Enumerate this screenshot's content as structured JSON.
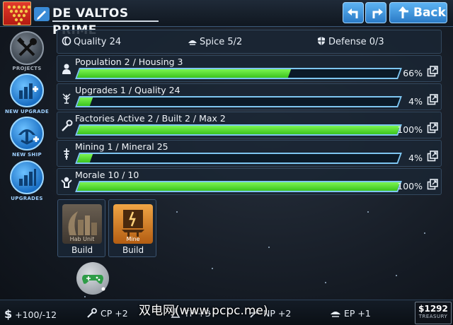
{
  "header": {
    "planet_name": "DE VALTOS PRIME",
    "back_label": "Back"
  },
  "sidebar": [
    {
      "label": "PROJECTS",
      "icon": "tools-icon",
      "style": "gray"
    },
    {
      "label": "NEW UPGRADE",
      "icon": "upgrade-plus-icon",
      "style": "blue"
    },
    {
      "label": "NEW SHIP",
      "icon": "ship-plus-icon",
      "style": "blue"
    },
    {
      "label": "UPGRADES",
      "icon": "upgrades-icon",
      "style": "blue"
    }
  ],
  "stats": {
    "quality": "Quality 24",
    "spice": "Spice 5/2",
    "defense": "Defense 0/3"
  },
  "resources": [
    {
      "label": "Population 2 / Housing 3",
      "percent_text": "66%",
      "fill": 0.66,
      "icon": "population-icon"
    },
    {
      "label": "Upgrades 1 / Quality 24",
      "percent_text": "4%",
      "fill": 0.04,
      "icon": "tree-icon"
    },
    {
      "label": "Factories Active 2 / Built 2 / Max 2",
      "percent_text": "100%",
      "fill": 1.0,
      "icon": "wrench-icon"
    },
    {
      "label": "Mining 1 / Mineral 25",
      "percent_text": "4%",
      "fill": 0.04,
      "icon": "drill-icon"
    },
    {
      "label": "Morale 10 / 10",
      "percent_text": "100%",
      "fill": 1.0,
      "icon": "morale-icon"
    }
  ],
  "build_options": [
    {
      "caption": "Hab Unit",
      "label": "Build"
    },
    {
      "caption": "Mine",
      "label": "Build"
    }
  ],
  "footer": {
    "credits": "+100/-12",
    "cp": "CP +2",
    "tp": "TP +3",
    "np": "NP +2",
    "ep": "EP +1",
    "treasury_amount": "$1292",
    "treasury_label": "TREASURY"
  },
  "watermark": "双电网(www.pcpc.me)",
  "colors": {
    "accent_blue": "#3a8bd6",
    "bar_green": "#4cd62a",
    "bar_border": "#7ec6f1",
    "panel_bg": "#1a2634"
  }
}
